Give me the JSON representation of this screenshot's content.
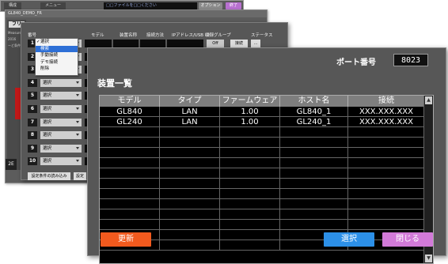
{
  "back_window": {
    "tab1": "構成",
    "tab2": "メニュー",
    "status": "□□ファイルを□□ください",
    "btn_gray": "オプション",
    "btn_purple": "終了",
    "subtitle": "GL840_DEMO_FR"
  },
  "mid_window": {
    "side_label": "フリ",
    "left_bits": [
      "Measure",
      "2016",
      "ーど条件"
    ]
  },
  "third_window": {
    "headers": [
      "番号",
      "モデル",
      "装置名称",
      "接続方法",
      "IPアドレス/USB ID",
      "収録グループ",
      "ステータス"
    ],
    "rows": [
      {
        "num": "1",
        "select": "選択",
        "group": "Off",
        "btn1": "接続",
        "btn2": "..."
      },
      {
        "num": "2",
        "select": "選択"
      },
      {
        "num": "3",
        "select": "選択"
      },
      {
        "num": "4",
        "select": "選択"
      },
      {
        "num": "5",
        "select": "選択"
      },
      {
        "num": "6",
        "select": "選択"
      },
      {
        "num": "7",
        "select": "選択"
      },
      {
        "num": "8",
        "select": "選択"
      },
      {
        "num": "9",
        "select": "選択"
      },
      {
        "num": "10",
        "select": "選択"
      }
    ],
    "bottom_btn1": "設定条件の読み込み",
    "bottom_btn2": "設定",
    "side_icon": "2E"
  },
  "dropdown": {
    "items": [
      "選択",
      "検索",
      "手動接続",
      "デモ接続",
      "削除"
    ],
    "checked_index": 0,
    "highlight_index": 1
  },
  "dialog": {
    "port_label": "ポート番号",
    "port_value": "8023",
    "title": "装置一覧",
    "columns": [
      "モデル",
      "タイプ",
      "ファームウェア",
      "ホスト名",
      "接続"
    ],
    "rows": [
      [
        "GL840",
        "LAN",
        "1.00",
        "GL840_1",
        "XXX.XXX.XXX"
      ],
      [
        "GL240",
        "LAN",
        "1.00",
        "GL240_1",
        "XXX.XXX.XXX"
      ]
    ],
    "refresh_label": "更新",
    "select_label": "選択",
    "close_label": "閉じる"
  },
  "colors": {
    "refresh": "#f25a1e",
    "select": "#2c90e8",
    "close": "#d27ad8"
  }
}
